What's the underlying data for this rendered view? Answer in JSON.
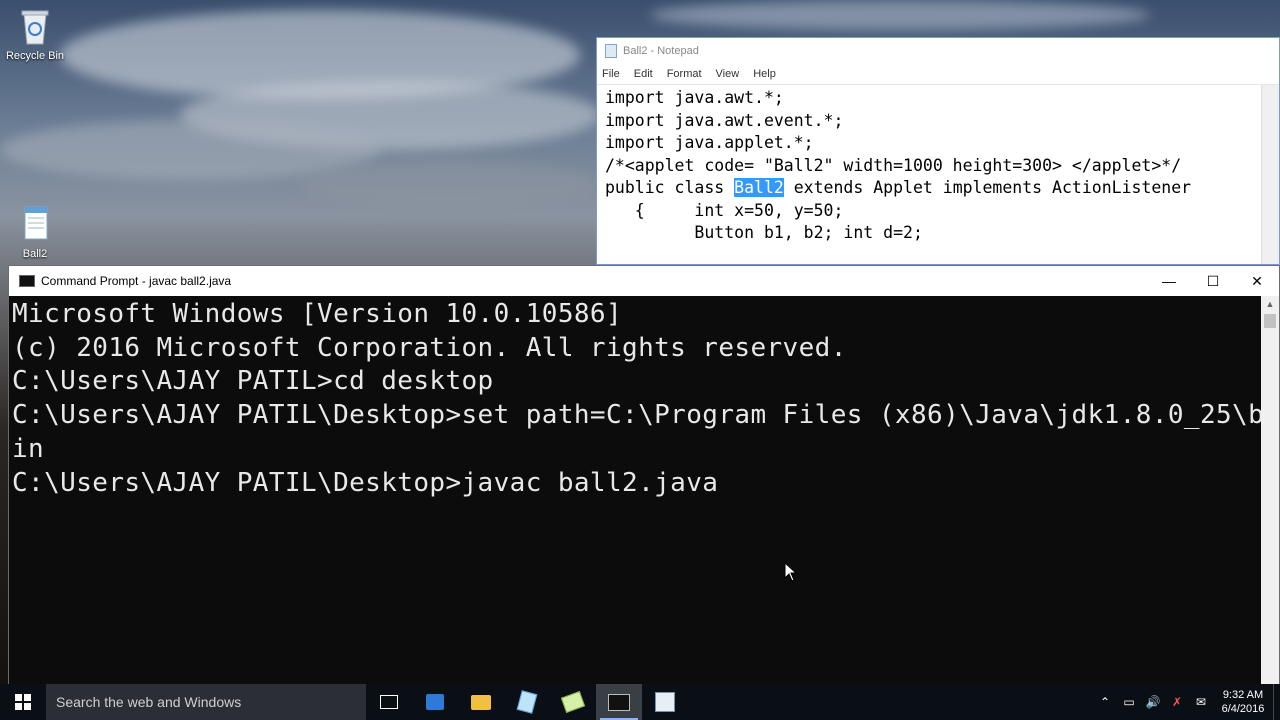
{
  "desktop": {
    "icons": [
      {
        "label": "Recycle Bin",
        "icon": "recycle-bin-icon"
      },
      {
        "label": "Ball2",
        "icon": "notepad-file-icon"
      }
    ]
  },
  "notepad": {
    "title": "Ball2 - Notepad",
    "menu": [
      "File",
      "Edit",
      "Format",
      "View",
      "Help"
    ],
    "lines": [
      "import java.awt.*;",
      "import java.awt.event.*;",
      "import java.applet.*;",
      "/*<applet code= \"Ball2\" width=1000 height=300> </applet>*/",
      "",
      "public class ",
      "   {     int x=50, y=50;",
      "         Button b1, b2; int d=2;"
    ],
    "class_line": {
      "prefix": "public class ",
      "selected": "Ball2",
      "suffix": " extends Applet implements ActionListener"
    }
  },
  "cmd": {
    "title": "Command Prompt - javac  ball2.java",
    "lines": [
      "Microsoft Windows [Version 10.0.10586]",
      "(c) 2016 Microsoft Corporation. All rights reserved.",
      "",
      "C:\\Users\\AJAY PATIL>cd desktop",
      "",
      "C:\\Users\\AJAY PATIL\\Desktop>set path=C:\\Program Files (x86)\\Java\\jdk1.8.0_25\\b",
      "in",
      "",
      "C:\\Users\\AJAY PATIL\\Desktop>javac ball2.java"
    ]
  },
  "taskbar": {
    "search_placeholder": "Search the web and Windows",
    "apps": [
      "task-view-icon",
      "store-icon",
      "file-explorer-icon",
      "notepad-icon",
      "notepad-icon",
      "command-prompt-icon",
      "paint-icon"
    ],
    "time": "9:32 AM",
    "date": "6/4/2016"
  },
  "colors": {
    "selection": "#3399ff",
    "console_bg": "#0c0c0c",
    "console_fg": "#e8e8e8",
    "taskbar_bg": "#0a0f16"
  }
}
